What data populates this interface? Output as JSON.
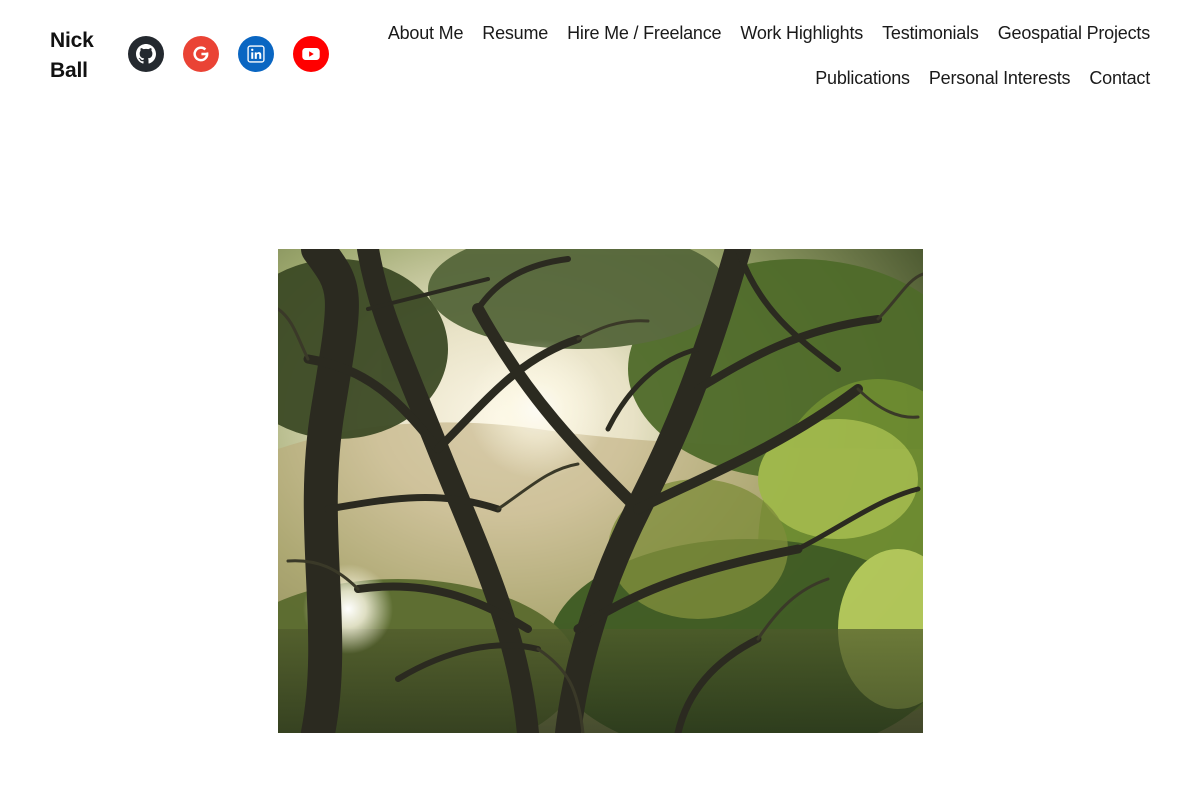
{
  "site": {
    "title_line1": "Nick",
    "title_line2": "Ball"
  },
  "social": [
    {
      "name": "github",
      "icon": "github-icon",
      "color": "#24292f"
    },
    {
      "name": "google",
      "icon": "google-icon",
      "color": "#ea4335"
    },
    {
      "name": "linkedin",
      "icon": "linkedin-icon",
      "color": "#0a66c2"
    },
    {
      "name": "youtube",
      "icon": "youtube-icon",
      "color": "#ff0000"
    }
  ],
  "nav": {
    "items": [
      "About Me",
      "Resume",
      "Hire Me / Freelance",
      "Work Highlights",
      "Testimonials",
      "Geospatial Projects",
      "Publications",
      "Personal Interests",
      "Contact"
    ]
  },
  "hero": {
    "subject": "forest-canopy-photo"
  }
}
